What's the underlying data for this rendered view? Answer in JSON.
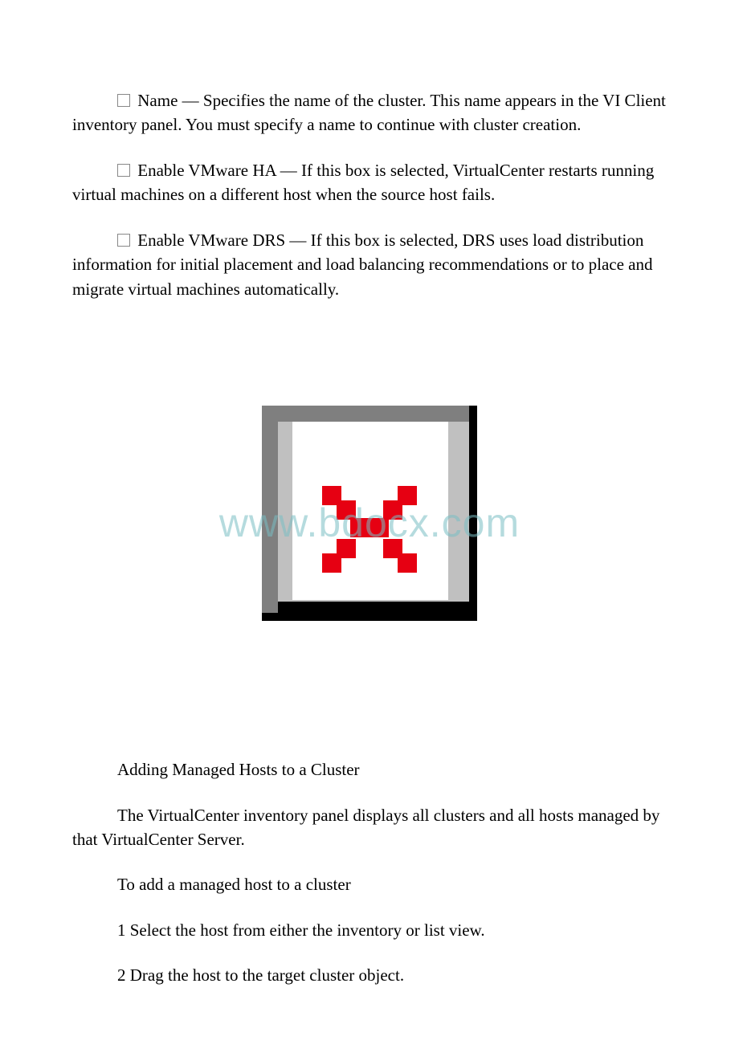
{
  "watermark": "www.bdocx.com",
  "para1": {
    "label": "Name",
    "text": " — Specifies the name of the cluster. This name appears in the VI Client inventory panel. You must specify a name to continue with cluster creation."
  },
  "para2": {
    "label": "Enable VMware HA",
    "text": " — If this box is selected, VirtualCenter restarts running virtual machines on a different host when the source host fails."
  },
  "para3": {
    "label": "Enable VMware DRS",
    "text": " — If this box is selected, DRS uses load distribution information for initial placement and load balancing recommendations or to place and migrate virtual machines automatically."
  },
  "section_heading": "Adding Managed Hosts to a Cluster",
  "para4": "The VirtualCenter inventory panel displays all clusters and all hosts managed by that VirtualCenter Server.",
  "para5": "To add a managed host to a cluster",
  "step1": "1 Select the host from either the inventory or list view.",
  "step2": "2 Drag the host to the target cluster object."
}
